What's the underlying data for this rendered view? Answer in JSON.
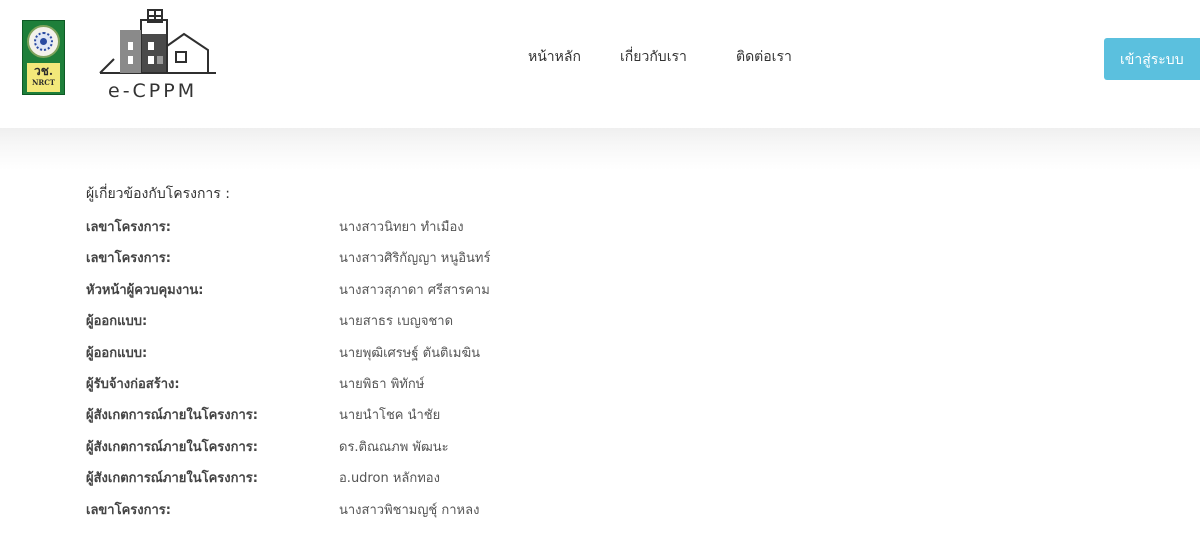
{
  "header": {
    "nrct_logo": {
      "thai_abbr": "วช.",
      "english_abbr": "NRCT"
    },
    "app_logo": {
      "text": "e-CPPM"
    },
    "nav": [
      {
        "label": "หน้าหลัก"
      },
      {
        "label": "เกี่ยวกับเรา"
      },
      {
        "label": "ติดต่อเรา"
      }
    ],
    "login_label": "เข้าสู่ระบบ"
  },
  "colors": {
    "login_button": "#5bc0de",
    "nrct_green": "#1e7f3a",
    "text": "#333333"
  },
  "main": {
    "section_title": "ผู้เกี่ยวข้องกับโครงการ :",
    "people": [
      {
        "role": "เลขาโครงการ:",
        "name": "นางสาวนิทยา ทำเมือง"
      },
      {
        "role": "เลขาโครงการ:",
        "name": "นางสาวศิริกัญญา หนูอินทร์"
      },
      {
        "role": "หัวหน้าผู้ควบคุมงาน:",
        "name": "นางสาวสุภาดา ศรีสารคาม"
      },
      {
        "role": "ผู้ออกแบบ:",
        "name": "นายสาธร เบญจชาด"
      },
      {
        "role": "ผู้ออกแบบ:",
        "name": "นายพุฒิเศรษฐ์ ตันติเมฆิน"
      },
      {
        "role": "ผู้รับจ้างก่อสร้าง:",
        "name": "นายพิธา พิทักษ์"
      },
      {
        "role": "ผู้สังเกตการณ์ภายในโครงการ:",
        "name": "นายนำโชค นำชัย"
      },
      {
        "role": "ผู้สังเกตการณ์ภายในโครงการ:",
        "name": "ดร.ติณณภพ พัฒนะ"
      },
      {
        "role": "ผู้สังเกตการณ์ภายในโครงการ:",
        "name": "อ.udron หลักทอง"
      },
      {
        "role": "เลขาโครงการ:",
        "name": "นางสาวพิชามญชุ์ กาหลง"
      }
    ]
  }
}
